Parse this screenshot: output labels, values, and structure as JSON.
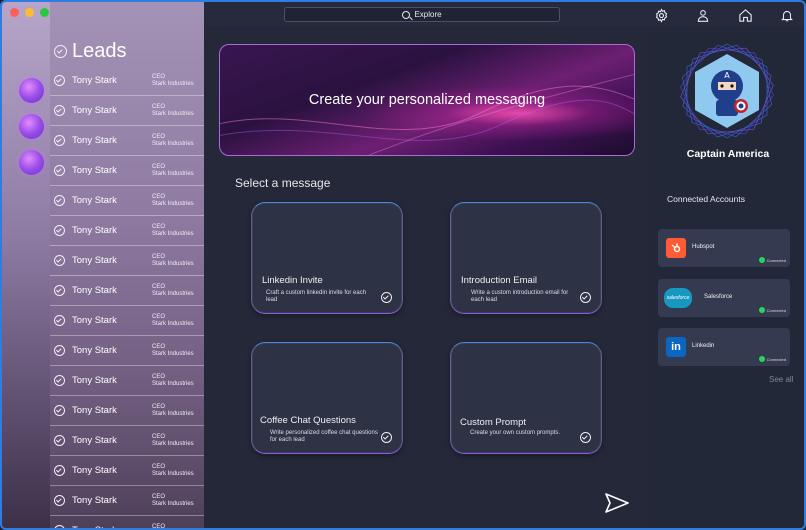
{
  "search": {
    "label": "Explore"
  },
  "leads": {
    "title": "Leads",
    "rows": [
      {
        "name": "Tony Stark",
        "title": "CEO",
        "company": "Stark Industries"
      },
      {
        "name": "Tony Stark",
        "title": "CEO",
        "company": "Stark Industries"
      },
      {
        "name": "Tony Stark",
        "title": "CEO",
        "company": "Stark Industries"
      },
      {
        "name": "Tony Stark",
        "title": "CEO",
        "company": "Stark Industries"
      },
      {
        "name": "Tony Stark",
        "title": "CEO",
        "company": "Stark Industries"
      },
      {
        "name": "Tony Stark",
        "title": "CEO",
        "company": "Stark Industries"
      },
      {
        "name": "Tony Stark",
        "title": "CEO",
        "company": "Stark Industries"
      },
      {
        "name": "Tony Stark",
        "title": "CEO",
        "company": "Stark Industries"
      },
      {
        "name": "Tony Stark",
        "title": "CEO",
        "company": "Stark Industries"
      },
      {
        "name": "Tony Stark",
        "title": "CEO",
        "company": "Stark Industries"
      },
      {
        "name": "Tony Stark",
        "title": "CEO",
        "company": "Stark Industries"
      },
      {
        "name": "Tony Stark",
        "title": "CEO",
        "company": "Stark Industries"
      },
      {
        "name": "Tony Stark",
        "title": "CEO",
        "company": "Stark Industries"
      },
      {
        "name": "Tony Stark",
        "title": "CEO",
        "company": "Stark Industries"
      },
      {
        "name": "Tony Stark",
        "title": "CEO",
        "company": "Stark Industries"
      },
      {
        "name": "Tony Stark",
        "title": "CEO",
        "company": "Stark Industries"
      }
    ]
  },
  "hero": {
    "title": "Create your personalized messaging"
  },
  "select_label": "Select a message",
  "cards": [
    {
      "title": "Linkedin Invite",
      "desc": "Craft a custom linkedin invite for each lead"
    },
    {
      "title": "Introduction Email",
      "desc": "Write a custom introduction email for each lead"
    },
    {
      "title": "Coffee Chat Questions",
      "desc": "Write personalized coffee chat questions for each lead"
    },
    {
      "title": "Custom Prompt",
      "desc": "Create your own custom prompts."
    }
  ],
  "profile": {
    "name": "Captain America"
  },
  "accounts": {
    "label": "Connected Accounts",
    "items": [
      {
        "name": "Hubspot",
        "status": "Connected",
        "logo_text": "h",
        "color": "#ff5c35"
      },
      {
        "name": "Salesforce",
        "status": "Connected",
        "logo_text": "salesforce",
        "color": "#1798c1"
      },
      {
        "name": "Linkedin",
        "status": "Connected",
        "logo_text": "in",
        "color": "#0a66c2"
      }
    ],
    "see_all": "See all"
  },
  "icons": [
    "settings-gear-icon",
    "user-icon",
    "home-icon",
    "bell-icon",
    "send-icon",
    "search-icon"
  ]
}
